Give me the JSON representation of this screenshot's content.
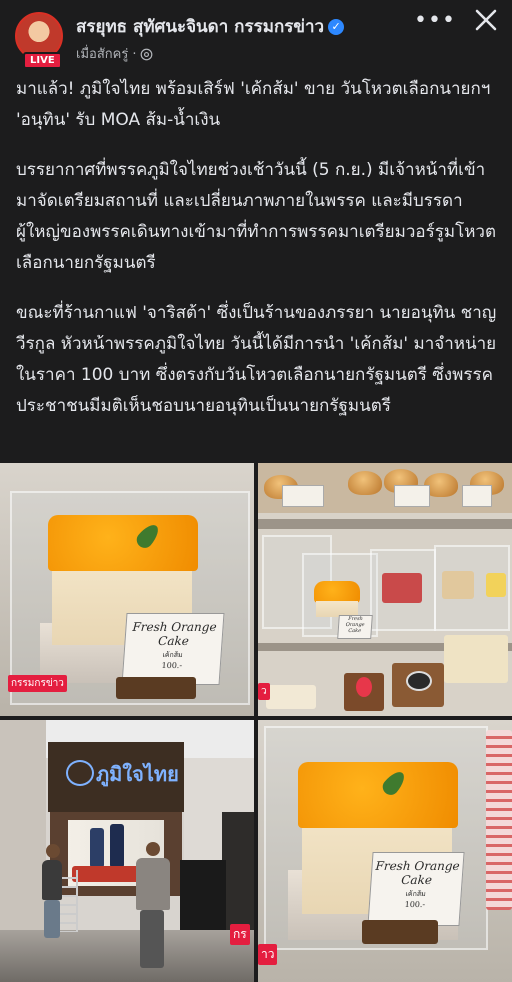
{
  "header": {
    "page_name": "สรยุทธ สุทัศนะจินดา กรรมกรข่าว",
    "live_label": "LIVE",
    "timestamp": "เมื่อสักครู่",
    "privacy_icon": "globe-icon",
    "more_icon": "more-horizontal-icon",
    "close_icon": "close-icon",
    "verified_color": "#2d88ff"
  },
  "post": {
    "paragraphs": [
      "มาแล้ว! ภูมิใจไทย พร้อมเสิร์ฟ 'เค้กส้ม' ขาย วันโหวตเลือกนายกฯ 'อนุทิน' รับ MOA ส้ม-น้ำเงิน",
      "บรรยากาศที่พรรคภูมิใจไทยช่วงเช้าวันนี้ (5 ก.ย.) มีเจ้าหน้าที่เข้ามาจัดเตรียมสถานที่ และเปลี่ยนภาพภายในพรรค และมีบรรดาผู้ใหญ่ของพรรคเดินทางเข้ามาที่ทำการพรรคมาเตรียมวอร์รูมโหวตเลือกนายกรัฐมนตรี",
      "ขณะที่ร้านกาแฟ 'จาริสต้า' ซึ่งเป็นร้านของภรรยา นายอนุทิน ชาญวีรกูล หัวหน้าพรรคภูมิใจไทย วันนี้ได้มีการนำ 'เค้กส้ม' มาจำหน่าย ในราคา 100 บาท ซึ่งตรงกับวันโหวตเลือกนายกรัฐมนตรี ซึ่งพรรคประชาชนมีมติเห็นชอบนายอนุทินเป็นนายกรัฐมนตรี"
    ]
  },
  "media": {
    "tile1": {
      "sign_name": "Fresh Orange Cake",
      "sign_sub": "เค้กส้ม",
      "sign_price": "100.-",
      "watermark": "กรรมกรข่าว"
    },
    "tile2": {
      "sign_name": "Fresh Orange Cake",
      "watermark": "ว"
    },
    "tile3": {
      "logo_text": "ภูมิใจไทย",
      "watermark": "กร"
    },
    "tile4": {
      "sign_name": "Fresh Orange Cake",
      "sign_sub": "เค้กส้ม",
      "sign_price": "100.-",
      "watermark": "าว"
    }
  }
}
